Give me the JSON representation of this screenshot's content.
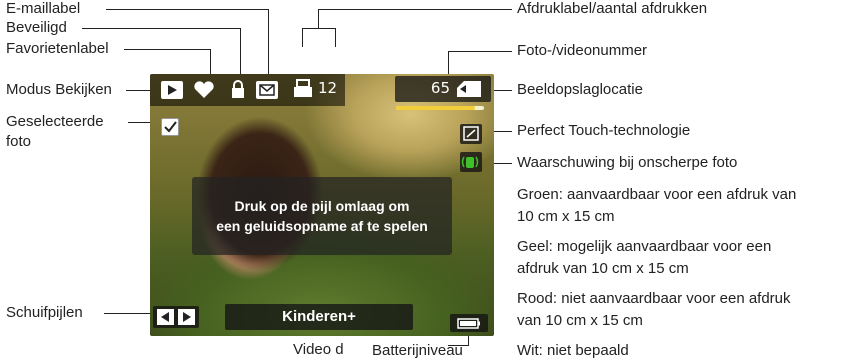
{
  "callouts_left": {
    "email_label": "E-maillabel",
    "protected": "Beveiligd",
    "favorites_label": "Favorietenlabel",
    "view_mode": "Modus Bekijken",
    "selected_photo_line1": "Geselecteerde",
    "selected_photo_line2": "foto",
    "scroll_arrows": "Schuifpijlen"
  },
  "callouts_right": {
    "print_label": "Afdruklabel/aantal afdrukken",
    "photo_video_number": "Foto-/videonummer",
    "storage_location": "Beeldopslaglocatie",
    "perfect_touch": "Perfect Touch-technologie",
    "blur_warning": "Waarschuwing bij onscherpe foto",
    "green_line1": "Groen: aanvaardbaar voor een afdruk van",
    "green_line2": "10 cm x 15 cm",
    "yellow_line1": "Geel: mogelijk aanvaardbaar voor een",
    "yellow_line2": "afdruk van 10 cm x 15 cm",
    "red_line1": "Rood: niet aanvaardbaar voor een afdruk",
    "red_line2": "van 10 cm x 15 cm",
    "white": "Wit: niet bepaald"
  },
  "callouts_bottom": {
    "battery_level": "Batterijniveau",
    "video_partial": "Video d"
  },
  "screen": {
    "print_count": "12",
    "photo_number": "65",
    "message_line1": "Druk op de pijl omlaag om",
    "message_line2": "een geluidsopname af te spelen",
    "album_label": "Kinderen+",
    "playback_progress": 0.9
  },
  "icons": {
    "view_mode": "play-icon",
    "favorite": "heart-icon",
    "protected": "lock-icon",
    "email": "envelope-icon",
    "print": "printer-icon",
    "storage": "memory-card-icon",
    "selected": "checkmark-icon",
    "perfect_touch": "perfect-touch-icon",
    "blur_warning": "shaking-hand-icon",
    "scroll": "scroll-arrows-icon",
    "battery": "battery-icon"
  },
  "colors": {
    "blur_warning_green": "#3fbf2a",
    "progress_yellow": "#f2cf3a"
  }
}
